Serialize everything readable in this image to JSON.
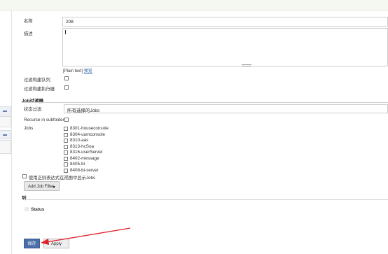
{
  "form": {
    "name_label": "名称",
    "name_value": "208",
    "description_label": "描述",
    "description_value": "",
    "plain_text": "[Plain text]",
    "preview_link": "预览",
    "filter_build_queue_label": "过滤构建队列",
    "filter_build_executors_label": "过滤构建执行器"
  },
  "job_filters": {
    "section_title": "Job过滤器",
    "status_filter_label": "状态过滤",
    "status_filter_value": "所有选择的Jobs",
    "recurse_label": "Recurse in subfolders",
    "jobs_label": "Jobs",
    "jobs": [
      {
        "name": "8301-houseconsole",
        "checked": false
      },
      {
        "name": "8304-uumconsole",
        "checked": false
      },
      {
        "name": "8310-aas",
        "checked": false
      },
      {
        "name": "8313-hcSoa",
        "checked": false
      },
      {
        "name": "8316-userServer",
        "checked": false
      },
      {
        "name": "8402-message",
        "checked": false
      },
      {
        "name": "8405-bi",
        "checked": false
      },
      {
        "name": "8408-bi-server",
        "checked": false
      }
    ],
    "regex_label": "使用正则表达式在视图中显示Jobs",
    "add_filter_label": "Add Job Filter"
  },
  "columns": {
    "section_title": "列",
    "status_label": "Status"
  },
  "buttons": {
    "save_label": "保存",
    "apply_label": "Apply"
  },
  "colors": {
    "save_button": "#4b6ea8",
    "annotation_arrow": "#e0202a"
  }
}
